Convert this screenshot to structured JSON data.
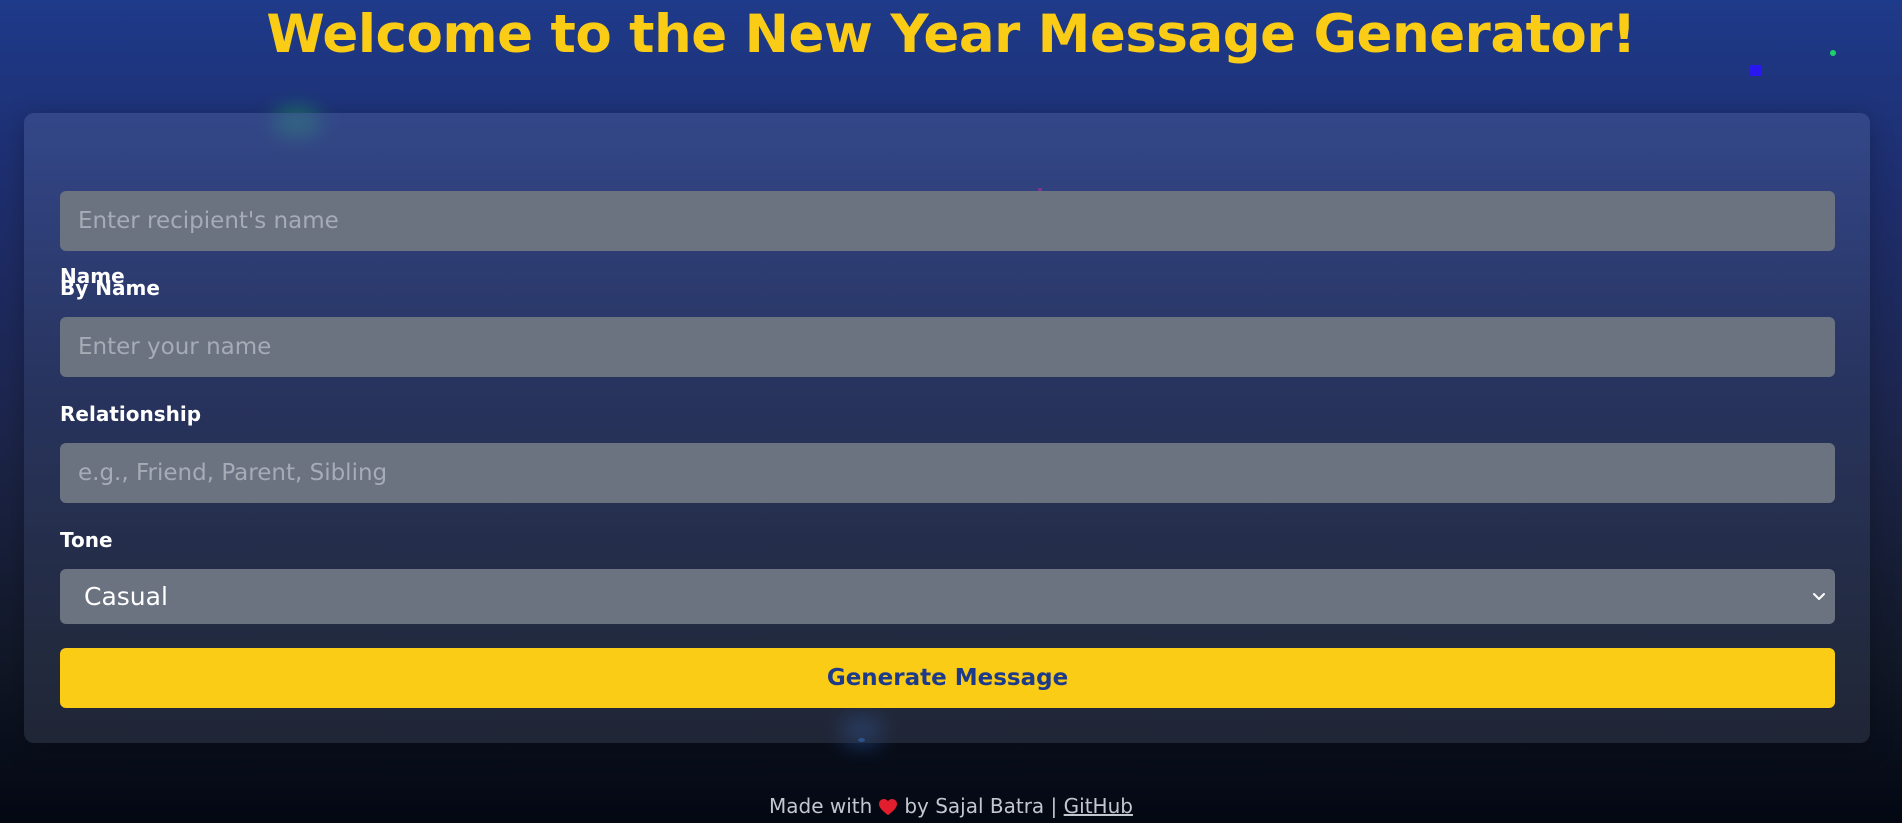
{
  "header": {
    "title": "Welcome to the New Year Message Generator!"
  },
  "form": {
    "name_label": "Name",
    "name_placeholder": "Enter recipient's name",
    "name_value": "",
    "by_name_label": "By Name",
    "by_name_placeholder": "Enter your name",
    "by_name_value": "",
    "relationship_label": "Relationship",
    "relationship_placeholder": "e.g., Friend, Parent, Sibling",
    "relationship_value": "",
    "tone_label": "Tone",
    "tone_selected": "Casual",
    "generate_label": "Generate Message"
  },
  "footer": {
    "made_with": "Made with",
    "heart_icon": "heart-icon",
    "by_text": "by Sajal Batra |",
    "link_label": "GitHub"
  },
  "colors": {
    "accent": "#facc15",
    "button_text": "#1e3a8a",
    "input_bg": "#6b7280",
    "heart": "#e11d2e"
  }
}
